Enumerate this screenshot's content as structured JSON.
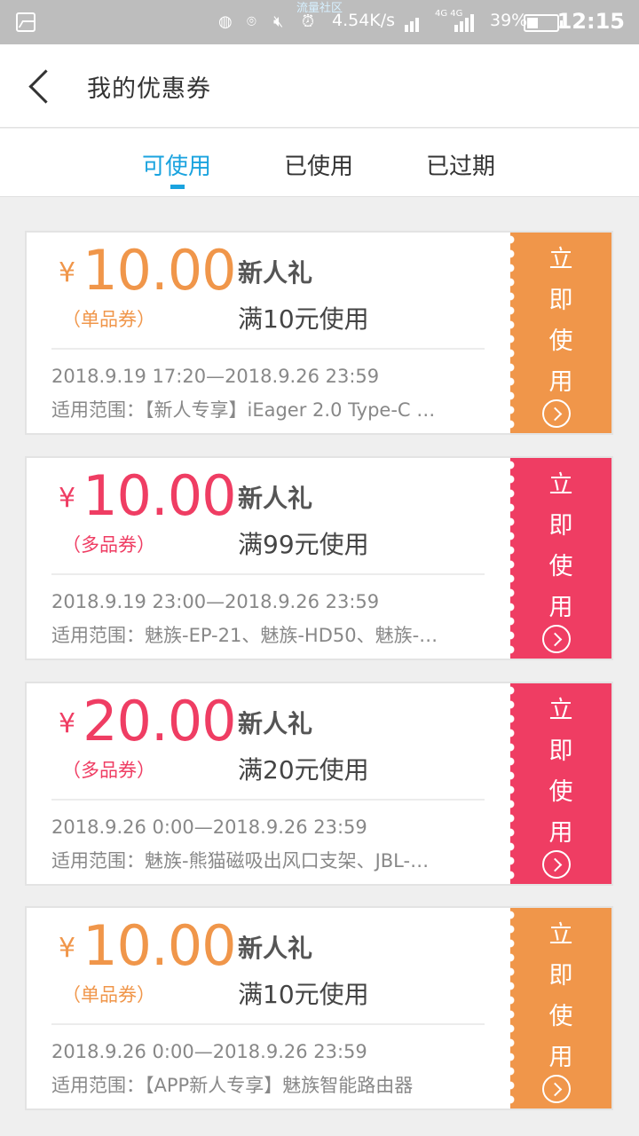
{
  "status_bar": {
    "network_speed": "4.54K/s",
    "top_label": "流量社区",
    "network_type": "4G 4G",
    "battery": "39%",
    "battery_level": 0.39,
    "time": "12:15"
  },
  "header": {
    "title": "我的优惠券",
    "back_icon": "chevron-left-icon"
  },
  "tabs": [
    {
      "label": "可使用",
      "active": true
    },
    {
      "label": "已使用",
      "active": false
    },
    {
      "label": "已过期",
      "active": false
    }
  ],
  "colors": {
    "accent": "#1aa3df",
    "single_item": "#f0964a",
    "multi_item": "#ef3d63"
  },
  "coupons": [
    {
      "currency": "¥",
      "amount": "10.00",
      "kind": "（单品券）",
      "name": "新人礼",
      "condition": "满10元使用",
      "date_range": "2018.9.19 17:20—2018.9.26 23:59",
      "scope": "适用范围：【新人专享】iEager 2.0 Type-C …",
      "color": "orange",
      "action": [
        "立",
        "即",
        "使",
        "用"
      ]
    },
    {
      "currency": "¥",
      "amount": "10.00",
      "kind": "（多品券）",
      "name": "新人礼",
      "condition": "满99元使用",
      "date_range": "2018.9.19 23:00—2018.9.26 23:59",
      "scope": "适用范围：魅族-EP-21、魅族-HD50、魅族-…",
      "color": "pink",
      "action": [
        "立",
        "即",
        "使",
        "用"
      ]
    },
    {
      "currency": "¥",
      "amount": "20.00",
      "kind": "（多品券）",
      "name": "新人礼",
      "condition": "满20元使用",
      "date_range": "2018.9.26 0:00—2018.9.26 23:59",
      "scope": "适用范围：魅族-熊猫磁吸出风口支架、JBL-…",
      "color": "pink",
      "action": [
        "立",
        "即",
        "使",
        "用"
      ]
    },
    {
      "currency": "¥",
      "amount": "10.00",
      "kind": "（单品券）",
      "name": "新人礼",
      "condition": "满10元使用",
      "date_range": "2018.9.26 0:00—2018.9.26 23:59",
      "scope": "适用范围：【APP新人专享】魅族智能路由器",
      "color": "orange",
      "action": [
        "立",
        "即",
        "使",
        "用"
      ]
    }
  ]
}
